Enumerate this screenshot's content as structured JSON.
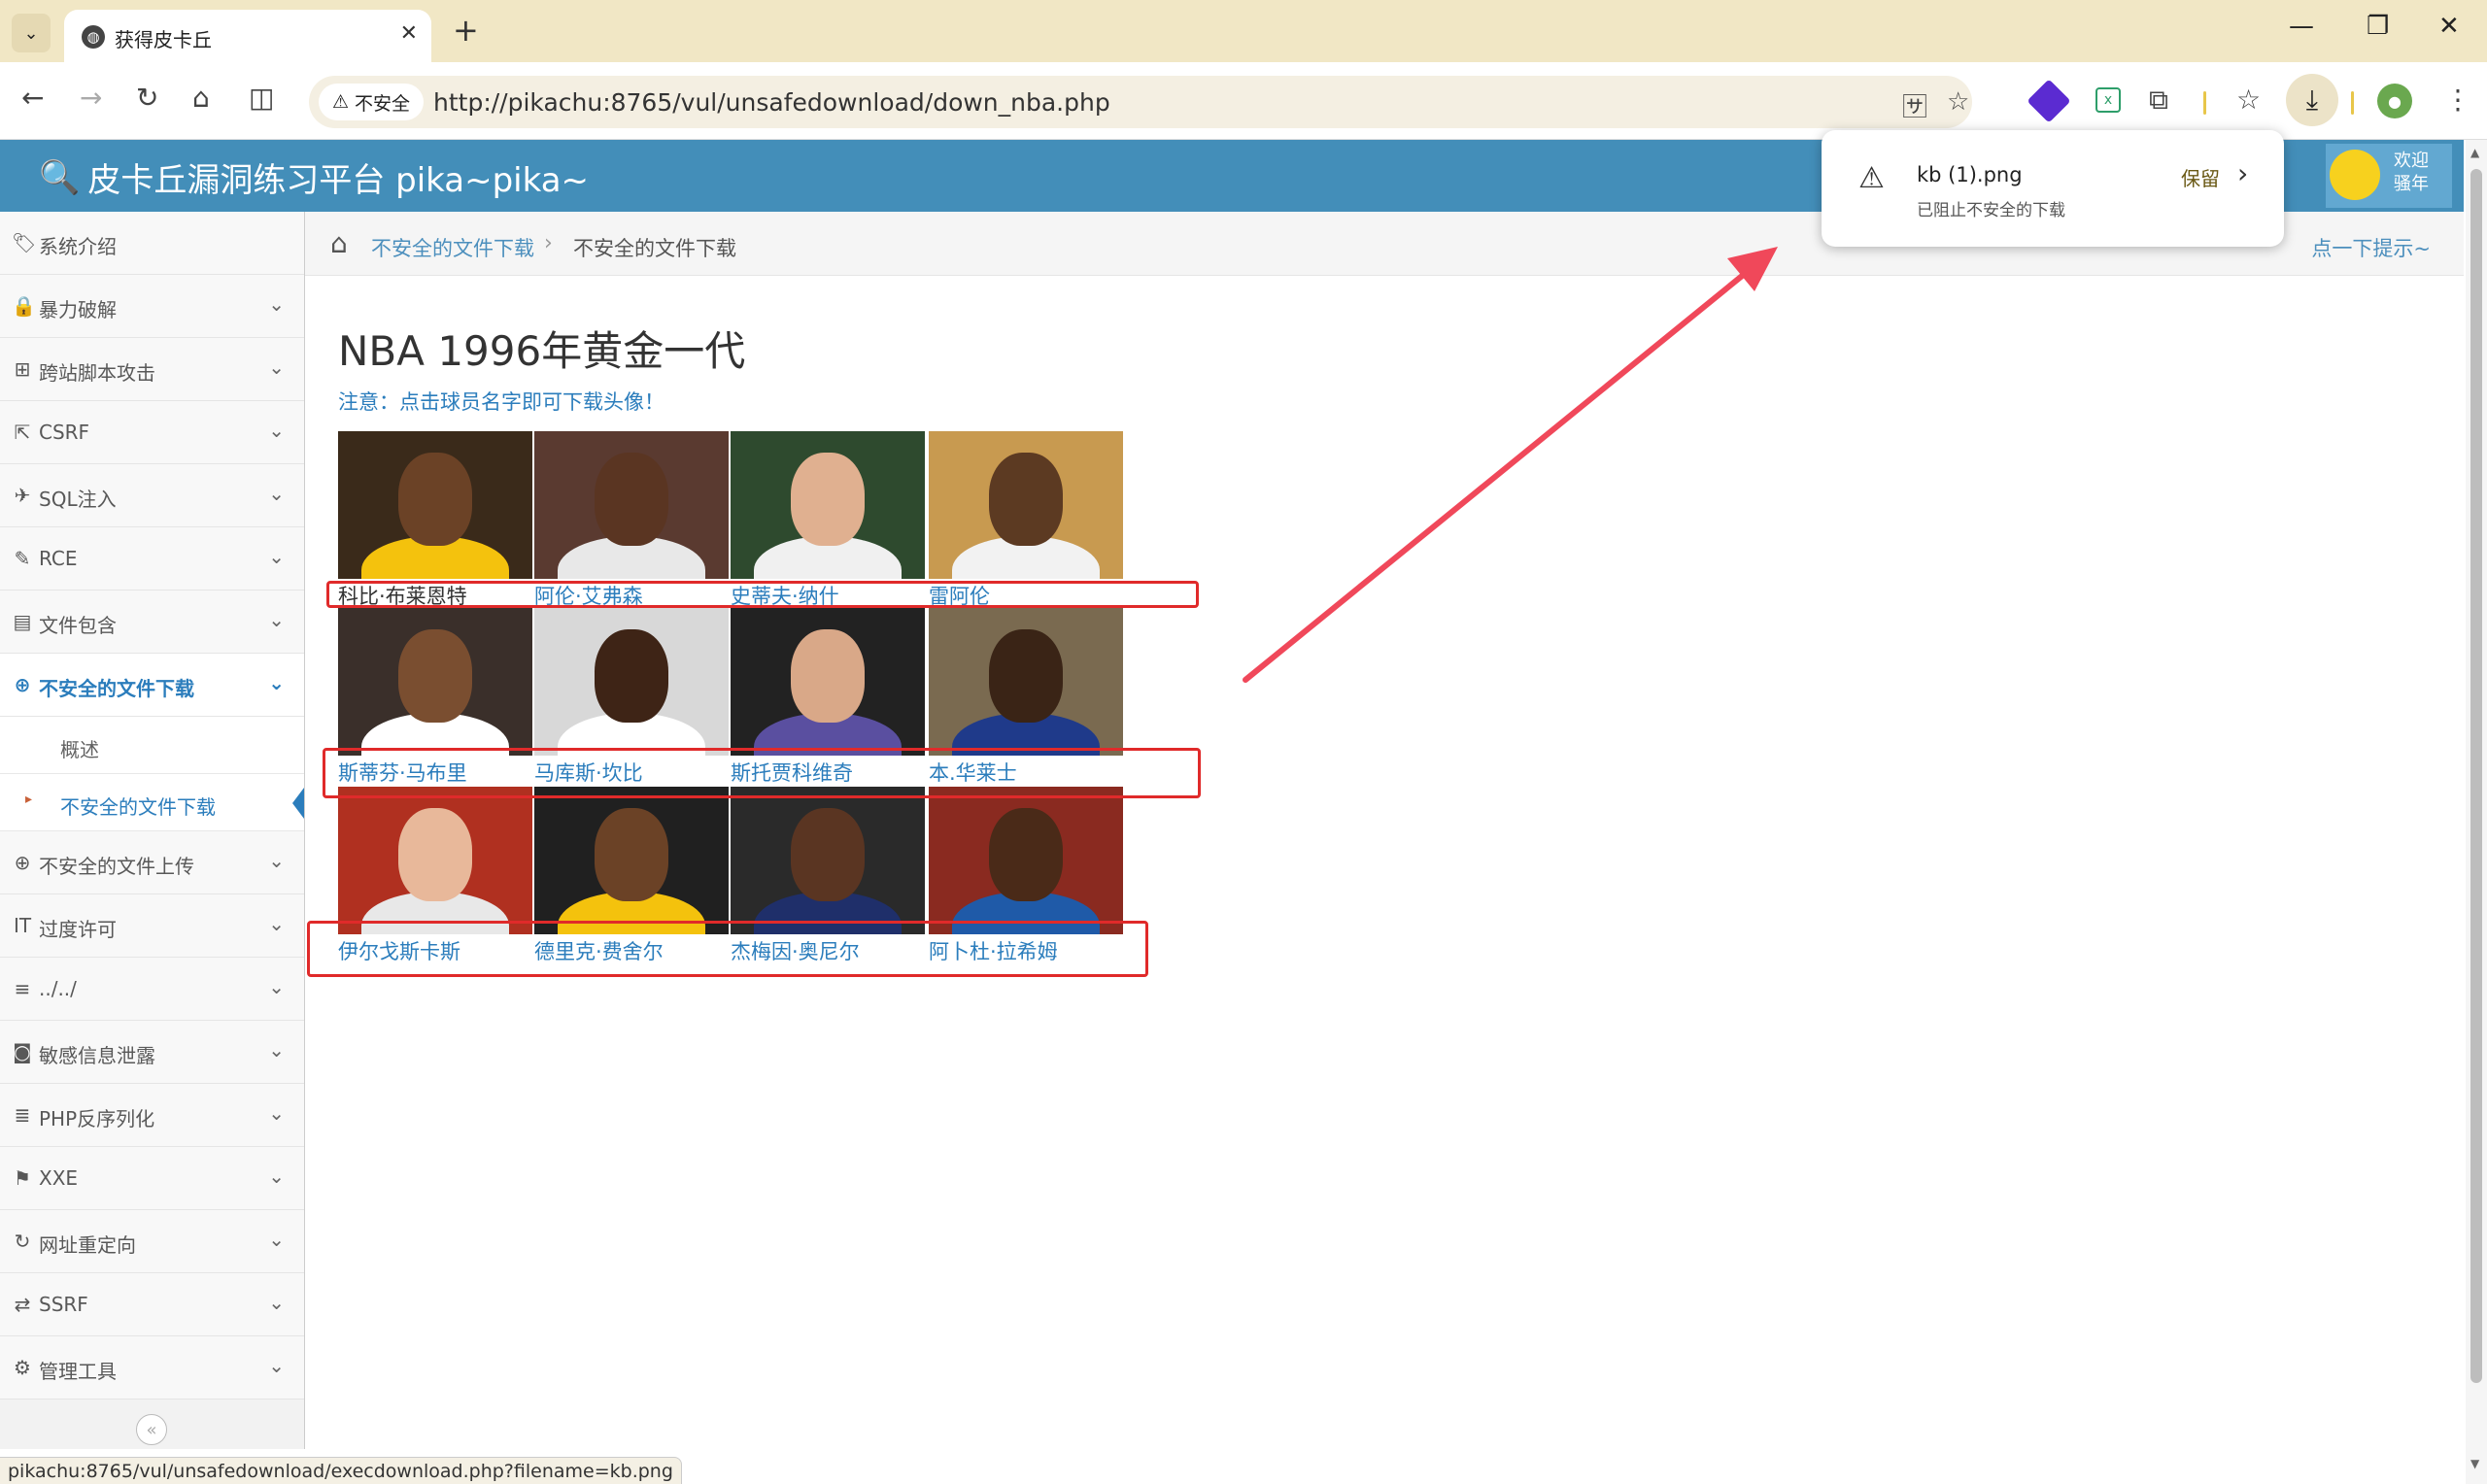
{
  "browser": {
    "tab_title": "获得皮卡丘",
    "url": "http://pikachu:8765/vul/unsafedownload/down_nba.php",
    "security_label": "不安全",
    "status_url": "pikachu:8765/vul/unsafedownload/execdownload.php?filename=kb.png"
  },
  "download": {
    "filename": "kb (1).png",
    "status": "已阻止不安全的下载",
    "keep_label": "保留"
  },
  "header": {
    "brand": "皮卡丘漏洞练习平台 pika~pika~",
    "welcome_line1": "欢迎",
    "welcome_line2": "骚年"
  },
  "sidebar": {
    "items": [
      {
        "label": "系统介绍",
        "icon": "tags-icon"
      },
      {
        "label": "暴力破解",
        "icon": "lock-icon"
      },
      {
        "label": "跨站脚本攻击",
        "icon": "sitemap-icon"
      },
      {
        "label": "CSRF",
        "icon": "external-link-icon"
      },
      {
        "label": "SQL注入",
        "icon": "fighter-jet-icon"
      },
      {
        "label": "RCE",
        "icon": "pencil-icon"
      },
      {
        "label": "文件包含",
        "icon": "file-icon"
      },
      {
        "label": "不安全的文件下载",
        "icon": "download-circle-icon"
      },
      {
        "label": "不安全的文件上传",
        "icon": "upload-circle-icon"
      },
      {
        "label": "过度许可",
        "icon": "text-height-icon"
      },
      {
        "label": "../../",
        "icon": "align-justify-icon"
      },
      {
        "label": "敏感信息泄露",
        "icon": "camera-icon"
      },
      {
        "label": "PHP反序列化",
        "icon": "align-left-icon"
      },
      {
        "label": "XXE",
        "icon": "flag-icon"
      },
      {
        "label": "网址重定向",
        "icon": "refresh-icon"
      },
      {
        "label": "SSRF",
        "icon": "exchange-icon"
      },
      {
        "label": "管理工具",
        "icon": "cog-icon"
      }
    ],
    "sub_items": [
      "概述",
      "不安全的文件下载"
    ]
  },
  "breadcrumbs": {
    "link": "不安全的文件下载",
    "current": "不安全的文件下载",
    "tip": "点一下提示~"
  },
  "main": {
    "title": "NBA 1996年黄金一代",
    "notice": "注意：点击球员名字即可下载头像！",
    "players": [
      {
        "name": "科比·布莱恩特",
        "jersey": "#f4c20d",
        "bg": "#3a2a1a",
        "skin": "#6b4226"
      },
      {
        "name": "阿伦·艾弗森",
        "jersey": "#e8e8e8",
        "bg": "#5a3a30",
        "skin": "#5a3522"
      },
      {
        "name": "史蒂夫·纳什",
        "jersey": "#f0f0f0",
        "bg": "#2e4a2e",
        "skin": "#e0b090"
      },
      {
        "name": "雷阿伦",
        "jersey": "#f2f2f2",
        "bg": "#c89a50",
        "skin": "#5c3a22"
      },
      {
        "name": "斯蒂芬·马布里",
        "jersey": "#ffffff",
        "bg": "#3a2f2a",
        "skin": "#7a4e30"
      },
      {
        "name": "马库斯·坎比",
        "jersey": "#ffffff",
        "bg": "#d8d8d8",
        "skin": "#3e2416"
      },
      {
        "name": "斯托贾科维奇",
        "jersey": "#5a4fa0",
        "bg": "#222222",
        "skin": "#d9a888"
      },
      {
        "name": "本.华莱士",
        "jersey": "#1f3a8a",
        "bg": "#7a6a50",
        "skin": "#3a2416"
      },
      {
        "name": "伊尔戈斯卡斯",
        "jersey": "#e8e8e8",
        "bg": "#b03020",
        "skin": "#e8b89a"
      },
      {
        "name": "德里克·费舍尔",
        "jersey": "#f4c20d",
        "bg": "#202020",
        "skin": "#6b4226"
      },
      {
        "name": "杰梅因·奥尼尔",
        "jersey": "#1f2f6a",
        "bg": "#2a2a2a",
        "skin": "#5a3522"
      },
      {
        "name": "阿卜杜·拉希姆",
        "jersey": "#1f5aa8",
        "bg": "#8a2a20",
        "skin": "#4a2a18"
      }
    ]
  },
  "colors": {
    "header_blue": "#438eb9",
    "link_blue": "#2b7dbc",
    "annotation_red": "#e02a2a",
    "arrow_red": "#f0485a"
  }
}
